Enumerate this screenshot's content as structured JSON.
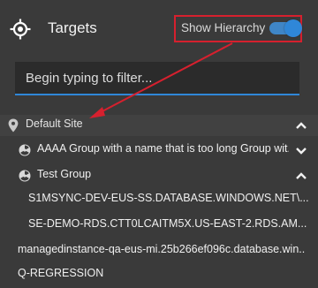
{
  "header": {
    "title": "Targets",
    "show_hierarchy_label": "Show Hierarchy",
    "show_hierarchy_on": true
  },
  "filter": {
    "placeholder": "Begin typing to filter..."
  },
  "tree": {
    "site": {
      "label": "Default Site",
      "expanded": true
    },
    "groups": [
      {
        "label": "AAAA Group with a name that is too long Group wit...",
        "expanded": false
      },
      {
        "label": "Test Group",
        "expanded": true
      }
    ],
    "targets": [
      "S1MSYNC-DEV-EUS-SS.DATABASE.WINDOWS.NET\\...",
      "SE-DEMO-RDS.CTT0LCAITM5X.US-EAST-2.RDS.AM...",
      "managedinstance-qa-eus-mi.25b266ef096c.database.win...",
      "Q-REGRESSION"
    ]
  },
  "icons": {
    "header": "crosshair-icon",
    "site": "map-pin-icon",
    "group": "radiation-icon",
    "expand": "chevron-up-icon",
    "collapse": "chevron-down-icon"
  },
  "colors": {
    "background": "#3a3a3a",
    "accent": "#2f87d8",
    "highlight": "#d6202e"
  }
}
